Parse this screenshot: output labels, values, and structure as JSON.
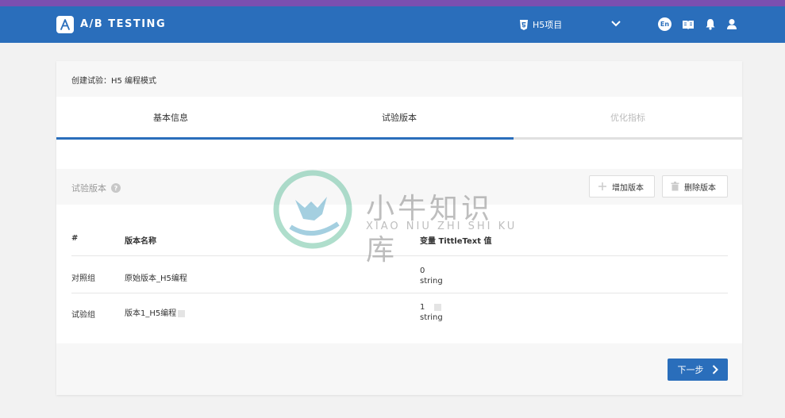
{
  "app": {
    "logo_text": "A/B TESTING"
  },
  "navbar": {
    "project_name": "H5项目",
    "language": "En"
  },
  "card": {
    "title": "创建试验：H5 编程模式"
  },
  "tabs": [
    {
      "label": "基本信息",
      "state": "done"
    },
    {
      "label": "试验版本",
      "state": "active"
    },
    {
      "label": "优化指标",
      "state": "disabled"
    }
  ],
  "section": {
    "title": "试验版本",
    "add_label": "增加版本",
    "delete_label": "删除版本"
  },
  "table": {
    "headers": [
      "#",
      "版本名称",
      "变量 TittleText 值"
    ],
    "rows": [
      {
        "group": "对照组",
        "name": "原始版本_H5编程",
        "value": "0",
        "type": "string",
        "editable": false
      },
      {
        "group": "试验组",
        "name": "版本1_H5编程",
        "value": "1",
        "type": "string",
        "editable": true
      }
    ]
  },
  "footer": {
    "next_label": "下一步"
  },
  "watermark": {
    "text": "小牛知识库",
    "sub": "XIAO NIU ZHI SHI KU"
  },
  "colors": {
    "primary": "#2a6ebb",
    "top_strip": "#7b4fb0",
    "background": "#f2f2f2"
  }
}
